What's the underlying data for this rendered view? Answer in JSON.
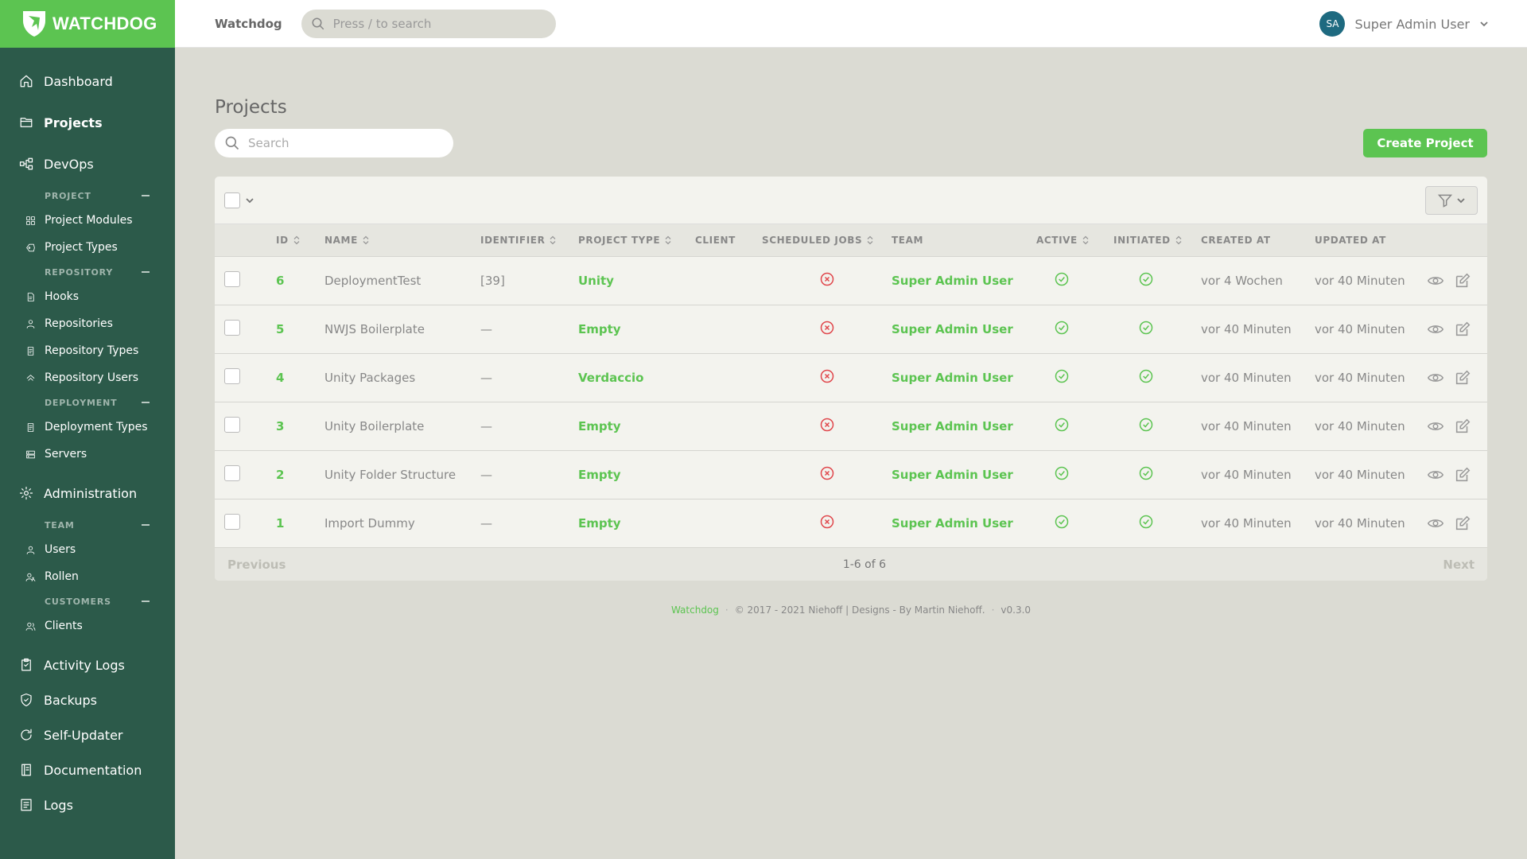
{
  "brand": {
    "name": "WATCHDOG"
  },
  "sidebar": {
    "top_items": [
      {
        "label": "Dashboard",
        "icon": "home-icon"
      },
      {
        "label": "Projects",
        "icon": "folder-icon",
        "active": true
      },
      {
        "label": "DevOps",
        "icon": "devops-icon"
      }
    ],
    "groups": [
      {
        "title": "PROJECT",
        "items": [
          {
            "label": "Project Modules",
            "icon": "modules-icon"
          },
          {
            "label": "Project Types",
            "icon": "tag-icon"
          }
        ]
      },
      {
        "title": "REPOSITORY",
        "items": [
          {
            "label": "Hooks",
            "icon": "hook-icon"
          },
          {
            "label": "Repositories",
            "icon": "repository-icon"
          },
          {
            "label": "Repository Types",
            "icon": "document-icon"
          },
          {
            "label": "Repository Users",
            "icon": "user-group-icon"
          }
        ]
      },
      {
        "title": "DEPLOYMENT",
        "items": [
          {
            "label": "Deployment Types",
            "icon": "document-icon"
          },
          {
            "label": "Servers",
            "icon": "server-icon"
          }
        ]
      }
    ],
    "administration": {
      "label": "Administration",
      "icon": "gear-icon"
    },
    "admin_groups": [
      {
        "title": "TEAM",
        "items": [
          {
            "label": "Users",
            "icon": "user-icon"
          },
          {
            "label": "Rollen",
            "icon": "roles-icon"
          }
        ]
      },
      {
        "title": "CUSTOMERS",
        "items": [
          {
            "label": "Clients",
            "icon": "clients-icon"
          }
        ]
      }
    ],
    "bottom_items": [
      {
        "label": "Activity Logs",
        "icon": "clipboard-icon"
      },
      {
        "label": "Backups",
        "icon": "shield-icon"
      },
      {
        "label": "Self-Updater",
        "icon": "refresh-icon"
      },
      {
        "label": "Documentation",
        "icon": "book-icon"
      },
      {
        "label": "Logs",
        "icon": "log-icon"
      }
    ]
  },
  "topbar": {
    "title": "Watchdog",
    "search_placeholder": "Press / to search",
    "user_initials": "SA",
    "user_name": "Super Admin User"
  },
  "page": {
    "title": "Projects",
    "search_placeholder": "Search",
    "create_label": "Create Project"
  },
  "table": {
    "columns": [
      {
        "label": "ID",
        "sortable": true
      },
      {
        "label": "NAME",
        "sortable": true
      },
      {
        "label": "IDENTIFIER",
        "sortable": true
      },
      {
        "label": "PROJECT TYPE",
        "sortable": true
      },
      {
        "label": "CLIENT",
        "sortable": false
      },
      {
        "label": "SCHEDULED JOBS",
        "sortable": true
      },
      {
        "label": "TEAM",
        "sortable": false
      },
      {
        "label": "ACTIVE",
        "sortable": true
      },
      {
        "label": "INITIATED",
        "sortable": true
      },
      {
        "label": "CREATED AT",
        "sortable": false
      },
      {
        "label": "UPDATED AT",
        "sortable": false
      }
    ],
    "rows": [
      {
        "id": "6",
        "name": "DeploymentTest",
        "identifier": "[39]",
        "type": "Unity",
        "client": "",
        "scheduled_jobs": false,
        "team": "Super Admin User",
        "active": true,
        "initiated": true,
        "created": "vor 4 Wochen",
        "updated": "vor 40 Minuten"
      },
      {
        "id": "5",
        "name": "NWJS Boilerplate",
        "identifier": "—",
        "type": "Empty",
        "client": "",
        "scheduled_jobs": false,
        "team": "Super Admin User",
        "active": true,
        "initiated": true,
        "created": "vor 40 Minuten",
        "updated": "vor 40 Minuten"
      },
      {
        "id": "4",
        "name": "Unity Packages",
        "identifier": "—",
        "type": "Verdaccio",
        "client": "",
        "scheduled_jobs": false,
        "team": "Super Admin User",
        "active": true,
        "initiated": true,
        "created": "vor 40 Minuten",
        "updated": "vor 40 Minuten"
      },
      {
        "id": "3",
        "name": "Unity Boilerplate",
        "identifier": "—",
        "type": "Empty",
        "client": "",
        "scheduled_jobs": false,
        "team": "Super Admin User",
        "active": true,
        "initiated": true,
        "created": "vor 40 Minuten",
        "updated": "vor 40 Minuten"
      },
      {
        "id": "2",
        "name": "Unity Folder Structure",
        "identifier": "—",
        "type": "Empty",
        "client": "",
        "scheduled_jobs": false,
        "team": "Super Admin User",
        "active": true,
        "initiated": true,
        "created": "vor 40 Minuten",
        "updated": "vor 40 Minuten"
      },
      {
        "id": "1",
        "name": "Import Dummy",
        "identifier": "—",
        "type": "Empty",
        "client": "",
        "scheduled_jobs": false,
        "team": "Super Admin User",
        "active": true,
        "initiated": true,
        "created": "vor 40 Minuten",
        "updated": "vor 40 Minuten"
      }
    ],
    "pagination": {
      "previous": "Previous",
      "info": "1-6 of 6",
      "next": "Next"
    }
  },
  "footer": {
    "brand": "Watchdog",
    "copyright": "© 2017 - 2021 Niehoff | Designs - By Martin Niehoff.",
    "version": "v0.3.0"
  },
  "colors": {
    "accent": "#5cc451",
    "sidebar_bg": "#2c5a4a",
    "page_bg": "#dbdbd3",
    "error_red": "#e0474c",
    "success_green": "#5cc451"
  }
}
